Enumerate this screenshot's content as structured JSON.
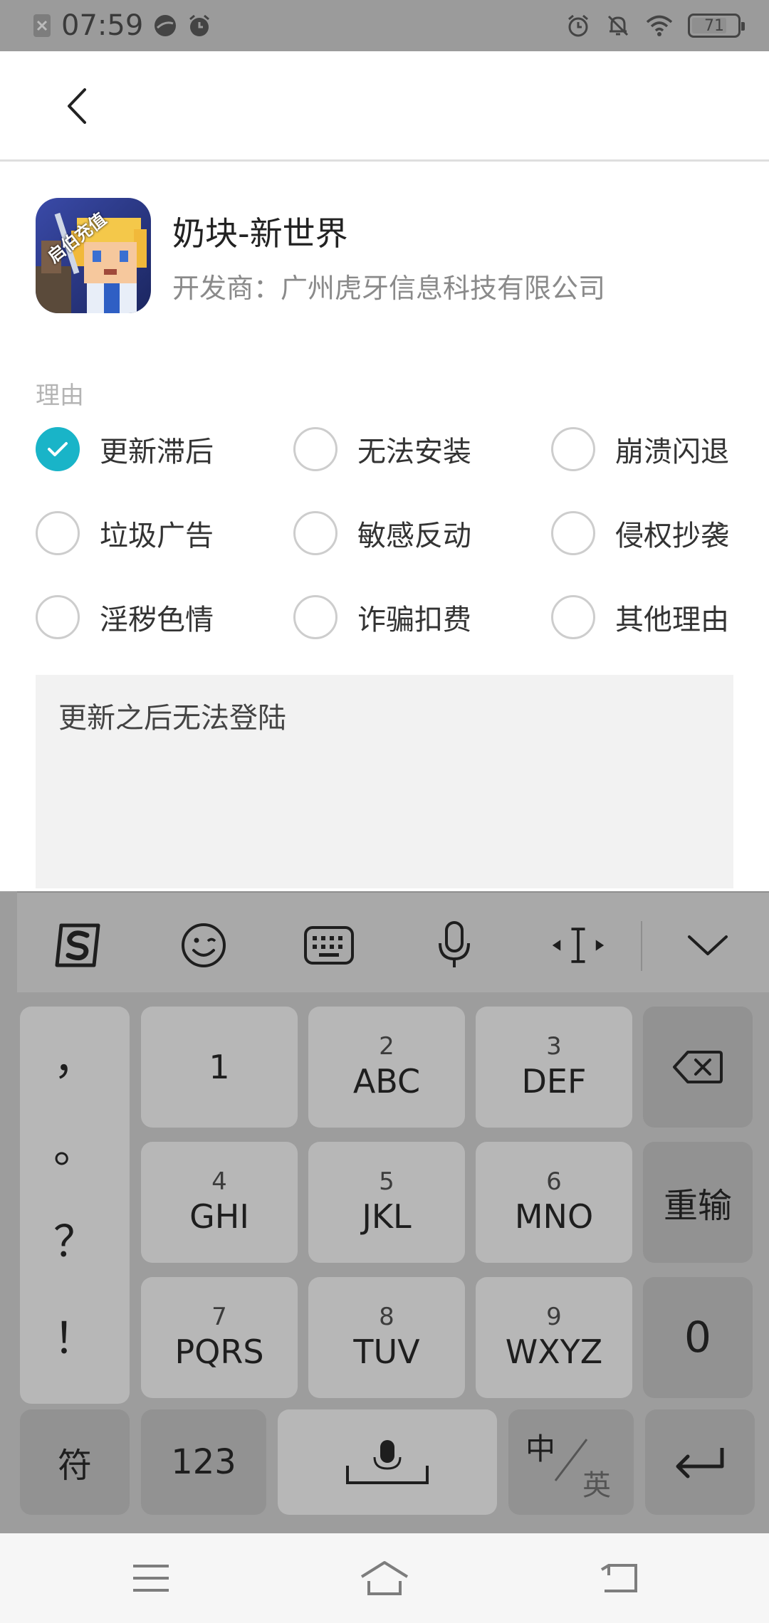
{
  "status_bar": {
    "time": "07:59",
    "battery": "71"
  },
  "header": {
    "back_icon": "chevron-left-icon"
  },
  "app": {
    "name": "奶块-新世界",
    "developer_label": "开发商：",
    "developer": "广州虎牙信息科技有限公司",
    "icon_badge": "启伯充值"
  },
  "reason": {
    "label": "理由",
    "options": [
      {
        "label": "更新滞后",
        "checked": true
      },
      {
        "label": "无法安装",
        "checked": false
      },
      {
        "label": "崩溃闪退",
        "checked": false
      },
      {
        "label": "垃圾广告",
        "checked": false
      },
      {
        "label": "敏感反动",
        "checked": false
      },
      {
        "label": "侵权抄袭",
        "checked": false
      },
      {
        "label": "淫秽色情",
        "checked": false
      },
      {
        "label": "诈骗扣费",
        "checked": false
      },
      {
        "label": "其他理由",
        "checked": false
      }
    ],
    "accent_color": "#19b4c8"
  },
  "description": {
    "value": "更新之后无法登陆"
  },
  "keyboard": {
    "toolbar": [
      "sogou-logo-icon",
      "emoji-icon",
      "keyboard-icon",
      "microphone-icon",
      "cursor-move-icon",
      "collapse-keyboard-icon"
    ],
    "punctuation": [
      "，",
      "。",
      "？",
      "！"
    ],
    "keys": [
      {
        "num": "",
        "letters": "1"
      },
      {
        "num": "2",
        "letters": "ABC"
      },
      {
        "num": "3",
        "letters": "DEF"
      },
      {
        "num": "4",
        "letters": "GHI"
      },
      {
        "num": "5",
        "letters": "JKL"
      },
      {
        "num": "6",
        "letters": "MNO"
      },
      {
        "num": "7",
        "letters": "PQRS"
      },
      {
        "num": "8",
        "letters": "TUV"
      },
      {
        "num": "9",
        "letters": "WXYZ"
      }
    ],
    "delete_icon": "backspace-icon",
    "reset": "重输",
    "zero": "0",
    "symbols": "符",
    "numbers": "123",
    "space_icon": "space-mic-icon",
    "lang_cn": "中",
    "lang_en": "英",
    "enter_icon": "enter-icon"
  },
  "nav_bar": {
    "icons": [
      "menu-icon",
      "home-icon",
      "back-icon"
    ]
  }
}
